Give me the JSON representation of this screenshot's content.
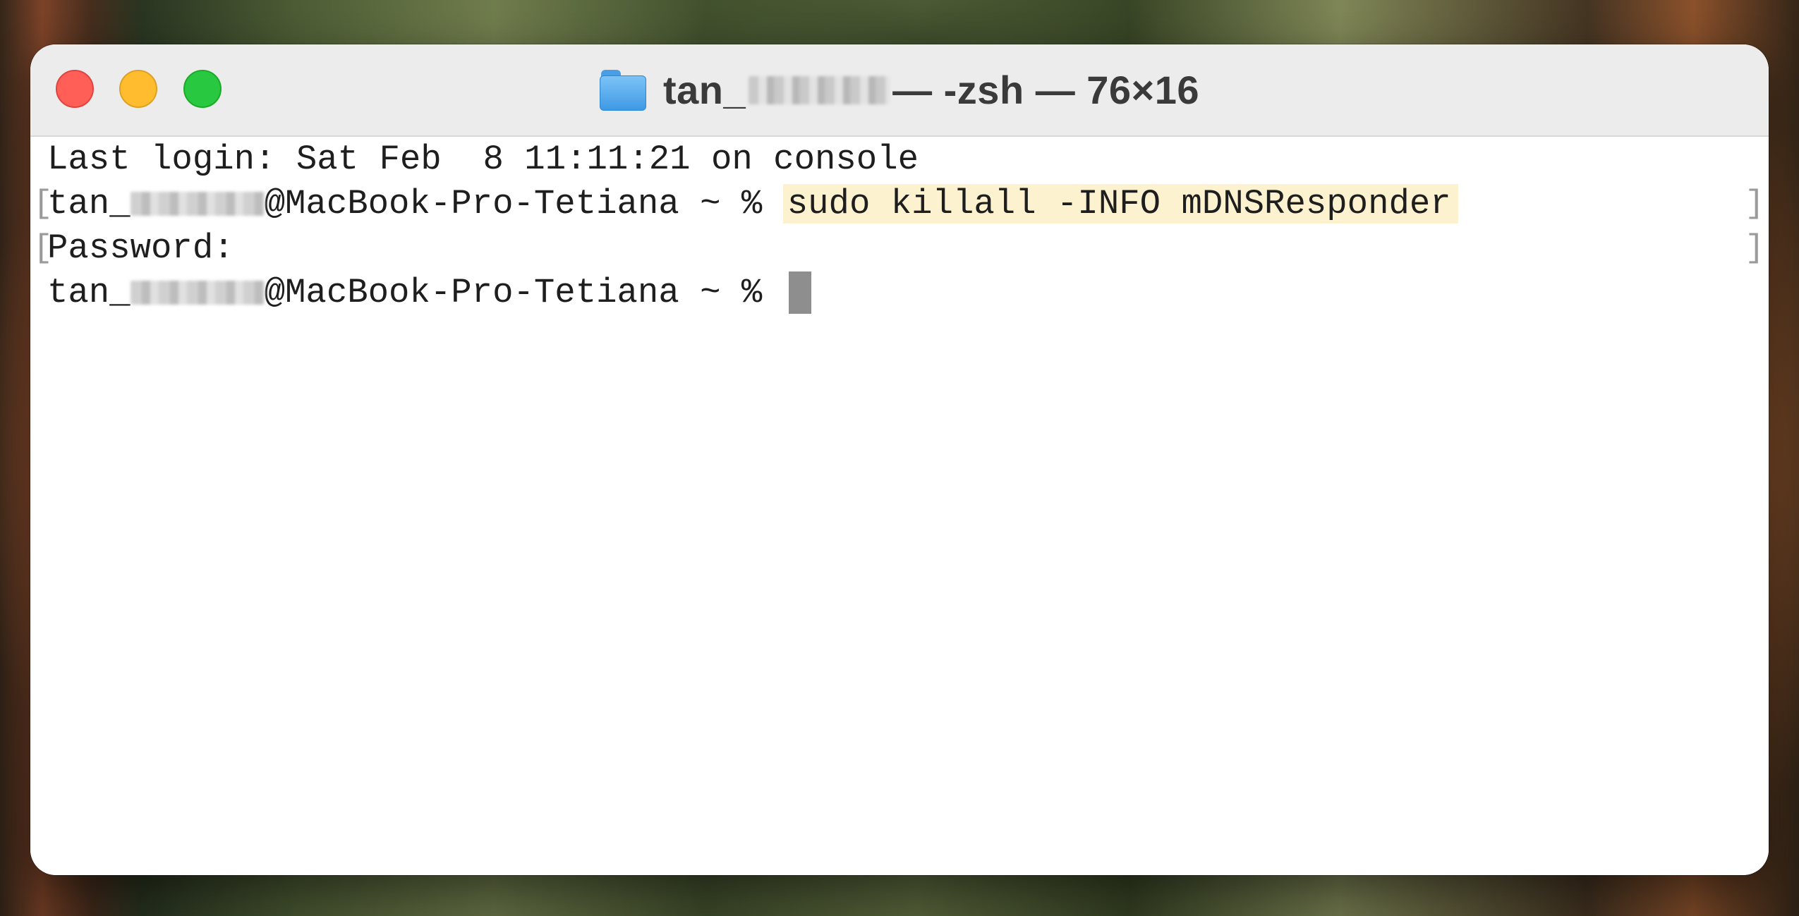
{
  "window": {
    "title_prefix": "tan_",
    "title_suffix": "— -zsh — 76×16",
    "folder_icon": "folder-icon"
  },
  "terminal": {
    "line1": "Last login: Sat Feb  8 11:11:21 on console",
    "prompt_user_prefix": "tan_",
    "prompt_host": "@MacBook-Pro-Tetiana ~ % ",
    "command": "sudo killall -INFO mDNSResponder",
    "password_label": "Password:",
    "mark_open": "[",
    "mark_close": "]"
  },
  "colors": {
    "command_highlight": "#fdf2cf",
    "cursor": "#8e8e8e",
    "close": "#ff5f57",
    "minimize": "#febc2e",
    "maximize": "#28c840"
  }
}
